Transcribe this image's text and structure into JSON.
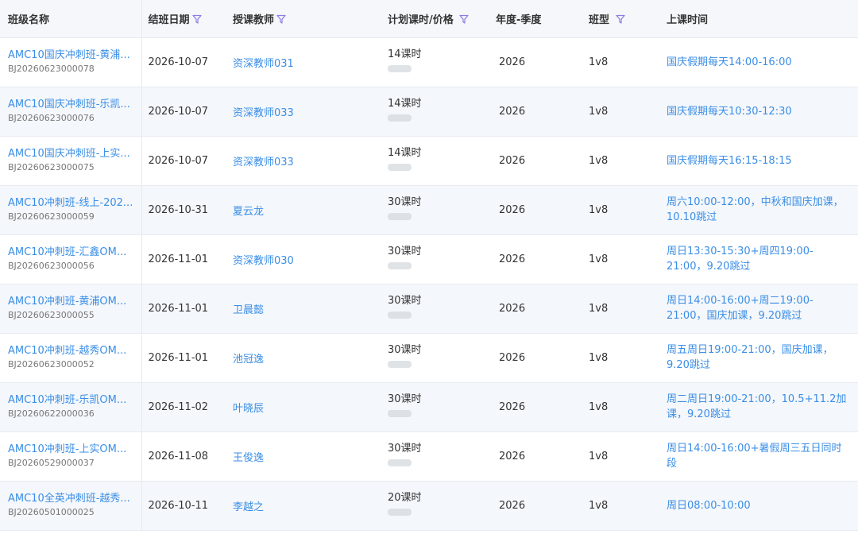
{
  "columns": {
    "name": "班级名称",
    "end_date": "结班日期",
    "teacher": "授课教师",
    "plan": "计划课时/价格",
    "year": "年度-季度",
    "type": "班型",
    "time": "上课时间"
  },
  "rows": [
    {
      "name": "AMC10国庆冲刺班-黄浦...",
      "code": "BJ20260623000078",
      "end_date": "2026-10-07",
      "teacher": "资深教师031",
      "plan": "14课时",
      "year": "2026",
      "type": "1v8",
      "time": "国庆假期每天14:00-16:00"
    },
    {
      "name": "AMC10国庆冲刺班-乐凯...",
      "code": "BJ20260623000076",
      "end_date": "2026-10-07",
      "teacher": "资深教师033",
      "plan": "14课时",
      "year": "2026",
      "type": "1v8",
      "time": "国庆假期每天10:30-12:30"
    },
    {
      "name": "AMC10国庆冲刺班-上实...",
      "code": "BJ20260623000075",
      "end_date": "2026-10-07",
      "teacher": "资深教师033",
      "plan": "14课时",
      "year": "2026",
      "type": "1v8",
      "time": "国庆假期每天16:15-18:15"
    },
    {
      "name": "AMC10冲刺班-线上-202...",
      "code": "BJ20260623000059",
      "end_date": "2026-10-31",
      "teacher": "夏云龙",
      "plan": "30课时",
      "year": "2026",
      "type": "1v8",
      "time": "周六10:00-12:00，中秋和国庆加课，10.10跳过"
    },
    {
      "name": "AMC10冲刺班-汇鑫OM...",
      "code": "BJ20260623000056",
      "end_date": "2026-11-01",
      "teacher": "资深教师030",
      "plan": "30课时",
      "year": "2026",
      "type": "1v8",
      "time": "周日13:30-15:30+周四19:00-21:00，9.20跳过"
    },
    {
      "name": "AMC10冲刺班-黄浦OM...",
      "code": "BJ20260623000055",
      "end_date": "2026-11-01",
      "teacher": "卫晨懿",
      "plan": "30课时",
      "year": "2026",
      "type": "1v8",
      "time": "周日14:00-16:00+周二19:00-21:00，国庆加课，9.20跳过"
    },
    {
      "name": "AMC10冲刺班-越秀OM...",
      "code": "BJ20260623000052",
      "end_date": "2026-11-01",
      "teacher": "池冠逸",
      "plan": "30课时",
      "year": "2026",
      "type": "1v8",
      "time": "周五周日19:00-21:00，国庆加课，9.20跳过"
    },
    {
      "name": "AMC10冲刺班-乐凯OM...",
      "code": "BJ20260622000036",
      "end_date": "2026-11-02",
      "teacher": "叶晓辰",
      "plan": "30课时",
      "year": "2026",
      "type": "1v8",
      "time": "周二周日19:00-21:00，10.5+11.2加课，9.20跳过"
    },
    {
      "name": "AMC10冲刺班-上实OM...",
      "code": "BJ20260529000037",
      "end_date": "2026-11-08",
      "teacher": "王俊逸",
      "plan": "30课时",
      "year": "2026",
      "type": "1v8",
      "time": "周日14:00-16:00+暑假周三五日同时段"
    },
    {
      "name": "AMC10全英冲刺班-越秀...",
      "code": "BJ20260501000025",
      "end_date": "2026-10-11",
      "teacher": "李越之",
      "plan": "20课时",
      "year": "2026",
      "type": "1v8",
      "time": "周日08:00-10:00"
    }
  ],
  "colors": {
    "link": "#3a8ee6",
    "header_bg": "#f5f7fa",
    "alt_row_bg": "#f4f7fb",
    "filter_icon": "#8f7ce6"
  }
}
